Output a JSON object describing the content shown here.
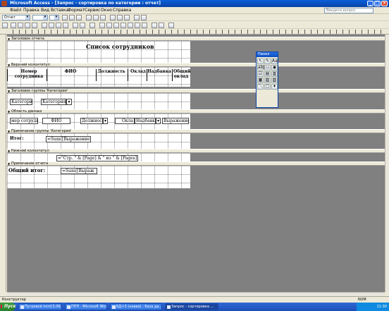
{
  "window": {
    "title": "Microsoft Access - [Запрос - сортировка по категории : отчет]",
    "controls": [
      "_",
      "□",
      "×"
    ]
  },
  "menu": {
    "items": [
      "Файл",
      "Правка",
      "Вид",
      "Вставка",
      "Формат",
      "Сервис",
      "Окно",
      "Справка"
    ],
    "help_placeholder": "Введите вопрос"
  },
  "toolbar": {
    "object_combo": "Отчет"
  },
  "bands": {
    "report_header": "Заголовок отчета",
    "page_header": "Верхний колонтитул",
    "group_header": "Заголовок группы 'Категория'",
    "detail": "Область данных",
    "group_footer": "Примечание группы 'Категория'",
    "page_footer": "Нижний колонтитул",
    "report_footer": "Примечание отчета"
  },
  "report": {
    "title": "Список сотрудников",
    "columns": [
      {
        "label": "Номер сотрудника"
      },
      {
        "label": "ФИО"
      },
      {
        "label": "Должность"
      },
      {
        "label": "Оклад"
      },
      {
        "label": "Надбавка"
      },
      {
        "label": "Общий оклад"
      }
    ],
    "group_label": "Категория",
    "group_field": "Категория",
    "detail_fields": [
      "мер сотрудн",
      "ФИО",
      "Должност",
      "Окла",
      "Надбавка",
      "Выражение1"
    ],
    "group_total_label": "Итог:",
    "group_total_expr": "=Sum([Выражение1])",
    "page_expr": "=\"Стр. \" & [Page] & \" из \" & [Pages]",
    "report_total_label": "Общий итог:",
    "report_total_expr": "=Sum([Выраж"
  },
  "toolbox": {
    "title": "Панел",
    "tools": [
      "↖",
      "✎",
      "Aa",
      "ab|",
      "▭",
      "◉",
      "☑",
      "▤",
      "▥",
      "▦",
      "▧",
      "▨",
      "＼",
      "▢",
      "✦"
    ]
  },
  "status": {
    "left": "Конструктор",
    "num": "NUM"
  },
  "taskbar": {
    "start": "Пуск",
    "items": [
      "Пугровой mml(3.06.2...",
      "ППП - Microsoft Word",
      "БД<3 (новая) : база да...",
      "Запрос - сортировка ..."
    ],
    "clock": "11:30"
  }
}
